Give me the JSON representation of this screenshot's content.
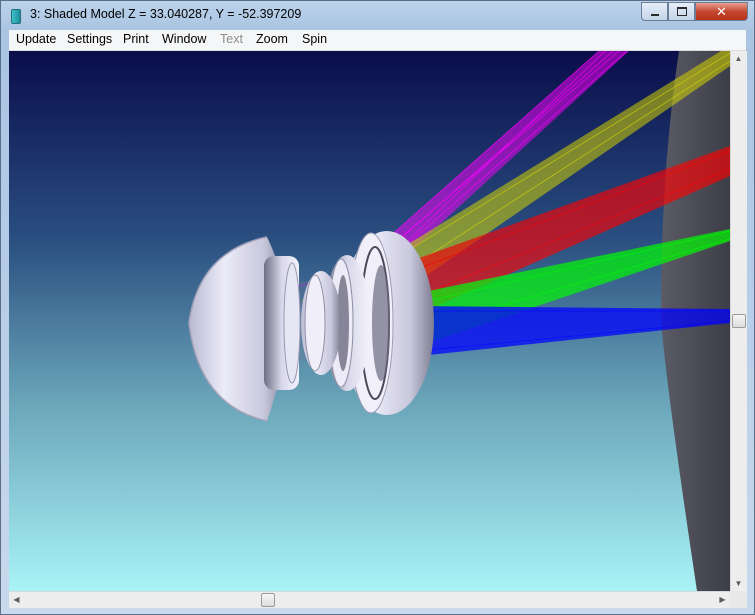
{
  "window": {
    "title": "3: Shaded Model Z = 33.040287, Y = -52.397209",
    "icon": "app-icon",
    "caption": {
      "minimize": "minimize-icon",
      "maximize": "maximize-icon",
      "close": "✕"
    }
  },
  "menubar": {
    "items": [
      {
        "label": "Update",
        "enabled": true
      },
      {
        "label": "Settings",
        "enabled": true
      },
      {
        "label": "Print",
        "enabled": true
      },
      {
        "label": "Window",
        "enabled": true
      },
      {
        "label": "Text",
        "enabled": false
      },
      {
        "label": "Zoom",
        "enabled": true
      },
      {
        "label": "Spin",
        "enabled": true
      }
    ]
  },
  "viewport": {
    "background_top": "#0a0d4a",
    "background_bottom": "#a9f3f7",
    "lens_color": "#d9d9ee",
    "image_plane_color": "#4b4b55",
    "ray_colors": [
      "#ff00ff",
      "#d4d400",
      "#ff0000",
      "#00ff00",
      "#0000ff"
    ]
  },
  "scrollbars": {
    "vertical": {
      "up": "▲",
      "down": "▼",
      "position": 0.5
    },
    "horizontal": {
      "left": "◀",
      "right": "▶",
      "position": 0.35
    }
  }
}
